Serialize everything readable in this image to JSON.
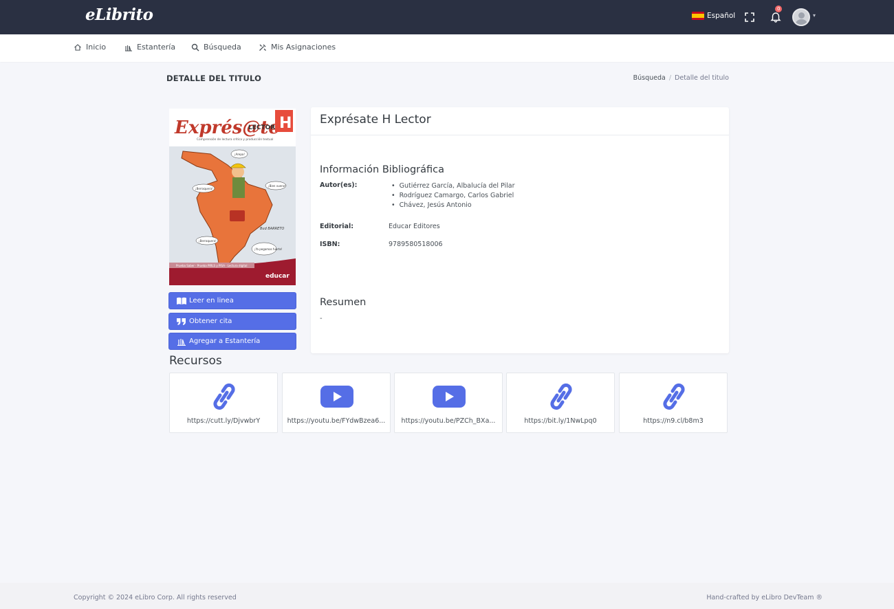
{
  "topbar": {
    "logo": "eLibrito",
    "language": "Español",
    "notification_count": "0"
  },
  "nav": {
    "items": [
      {
        "label": "Inicio",
        "icon": "home-icon"
      },
      {
        "label": "Estantería",
        "icon": "library-icon"
      },
      {
        "label": "Búsqueda",
        "icon": "search-icon"
      },
      {
        "label": "Mis Asignaciones",
        "icon": "tools-icon"
      }
    ]
  },
  "page": {
    "title": "DETALLE DEL TITULO",
    "breadcrumb": [
      "Búsqueda",
      "/",
      "Detalle del titulo"
    ]
  },
  "cover": {
    "title_main": "Exprés@te",
    "title_sub": "LECTOR",
    "badge": "H",
    "subtitle": "Comprensión de lectura crítica y producción textual",
    "bubbles": [
      "¡Arepa!",
      "¡Berraquera!",
      "¡Bien vueno!",
      "¡Berraquera!",
      "¡Ya pegamos fuerte!"
    ],
    "footer_tags": "Prueba Saber · Prueba PIRLS y PISA · Lectura digital",
    "publisher_logo": "educar",
    "signature": "Bud BARRETO"
  },
  "actions": {
    "read_online": "Leer en linea",
    "get_citation": "Obtener cita",
    "add_shelf": "Agregar a Estantería"
  },
  "detail": {
    "title": "Exprésate H Lector",
    "biblio_heading": "Información Bibliográfica",
    "authors_label": "Autor(es):",
    "authors": [
      "Gutiérrez García, Albalucía del Pilar",
      "Rodríguez Camargo, Carlos Gabriel",
      "Chávez, Jesús Antonio"
    ],
    "editorial_label": "Editorial:",
    "editorial": "Educar Editores",
    "isbn_label": "ISBN:",
    "isbn": "9789580518006",
    "summary_heading": "Resumen",
    "summary": "-"
  },
  "resources": {
    "heading": "Recursos",
    "items": [
      {
        "type": "link",
        "url": "https://cutt.ly/DjvwbrY"
      },
      {
        "type": "video",
        "url": "https://youtu.be/FYdwBzea6..."
      },
      {
        "type": "video",
        "url": "https://youtu.be/PZCh_BXa..."
      },
      {
        "type": "link",
        "url": "https://bit.ly/1NwLpq0"
      },
      {
        "type": "link",
        "url": "https://n9.cl/b8m3"
      }
    ]
  },
  "footer": {
    "copyright": "Copyright © 2024 eLibro Corp. All rights reserved",
    "credit": "Hand-crafted by eLibro DevTeam ®"
  },
  "colors": {
    "topbar": "#2a3042",
    "primary": "#556ee6",
    "badge": "#f46a6a"
  }
}
